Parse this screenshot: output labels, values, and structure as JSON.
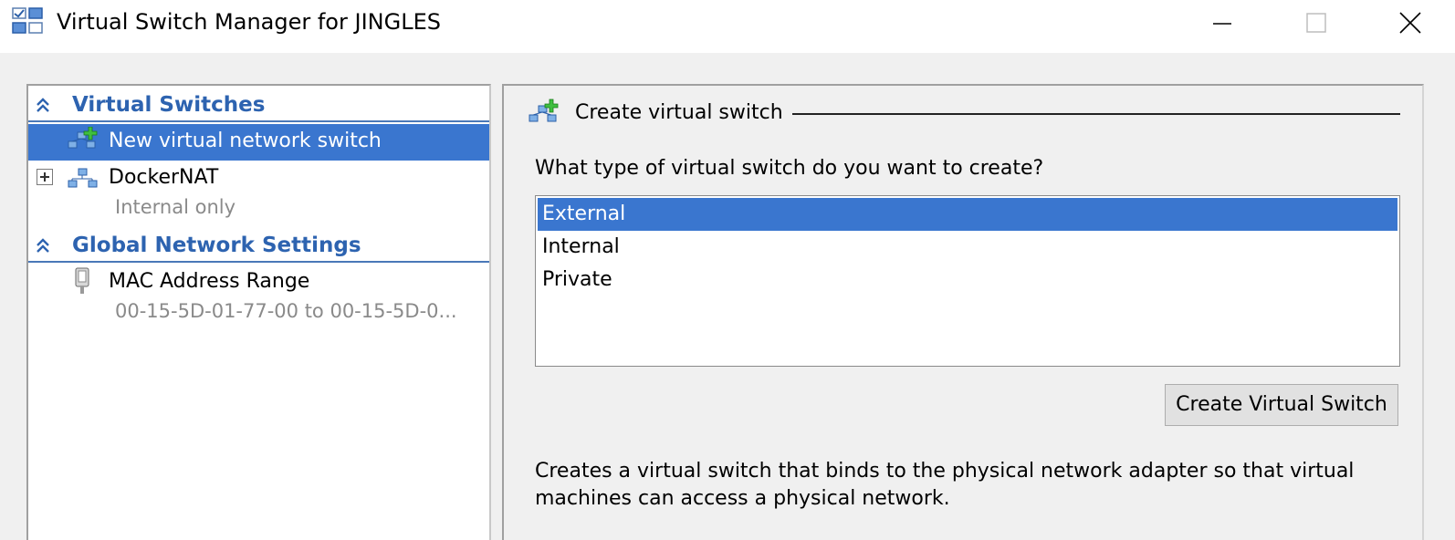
{
  "window": {
    "title": "Virtual Switch Manager for JINGLES",
    "icon": "virtual-switch-manager-icon",
    "controls": [
      "minimize-icon",
      "maximize-icon",
      "close-icon"
    ]
  },
  "left_pane": {
    "sections": [
      {
        "label": "Virtual Switches",
        "icon": "collapse-chevron-icon",
        "items": [
          {
            "label": "New virtual network switch",
            "icon": "new-switch-icon",
            "selected": true
          },
          {
            "label": "DockerNAT",
            "sub": "Internal only",
            "icon": "network-switch-icon",
            "expandable": true
          }
        ]
      },
      {
        "label": "Global Network Settings",
        "icon": "collapse-chevron-icon",
        "items": [
          {
            "label": "MAC Address Range",
            "sub": "00-15-5D-01-77-00 to 00-15-5D-0...",
            "icon": "mac-address-icon"
          }
        ]
      }
    ]
  },
  "right_pane": {
    "group_title": "Create virtual switch",
    "group_icon": "new-switch-icon",
    "question": "What type of virtual switch do you want to create?",
    "switch_types": [
      {
        "label": "External",
        "selected": true
      },
      {
        "label": "Internal",
        "selected": false
      },
      {
        "label": "Private",
        "selected": false
      }
    ],
    "create_button": "Create Virtual Switch",
    "description": "Creates a virtual switch that binds to the physical network adapter so that virtual machines can access a physical network."
  },
  "colors": {
    "selection": "#3a76cf",
    "section_header_text": "#2d63b0",
    "secondary_text": "#8a8a8a",
    "window_bg": "#f0f0f0"
  }
}
